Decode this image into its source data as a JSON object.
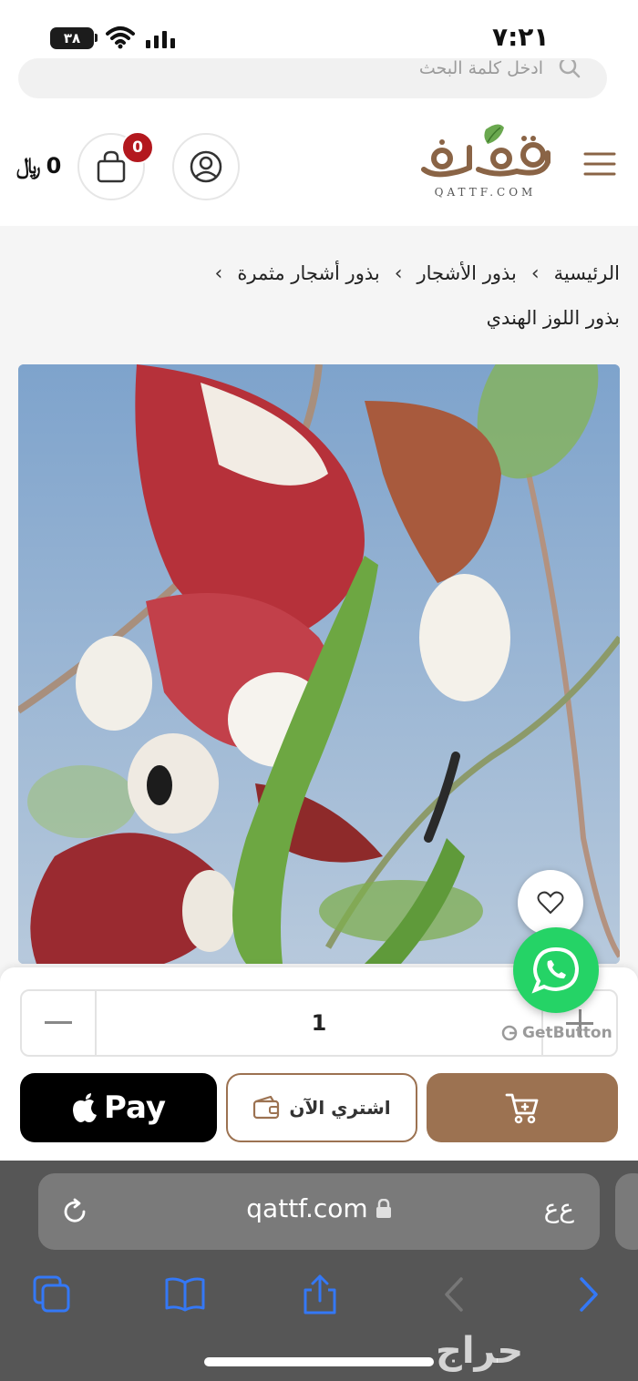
{
  "status_bar": {
    "time": "٧:٢١",
    "battery": "٣٨"
  },
  "search": {
    "placeholder": "ادخل كلمة البحث"
  },
  "header": {
    "logo_text": "QATTF.COM",
    "cart_count": "0",
    "cart_total": "0",
    "currency_symbol": "﷼"
  },
  "breadcrumb": {
    "items": [
      "الرئيسية",
      "بذور الأشجار",
      "بذور أشجار مثمرة"
    ],
    "separator": "›",
    "current": "بذور اللوز الهندي"
  },
  "product": {
    "quantity": "1"
  },
  "actions": {
    "apple_pay_label": "Pay",
    "buy_now_label": "اشتري الآن",
    "getbutton_label": "GetButton"
  },
  "browser": {
    "url": "qattf.com",
    "text_size_label": "ﻉﻉ"
  },
  "watermark": "حراج",
  "colors": {
    "brand_brown": "#9c7251",
    "badge_red": "#b3181e",
    "whatsapp_green": "#25d366",
    "safari_blue": "#3478f6"
  }
}
